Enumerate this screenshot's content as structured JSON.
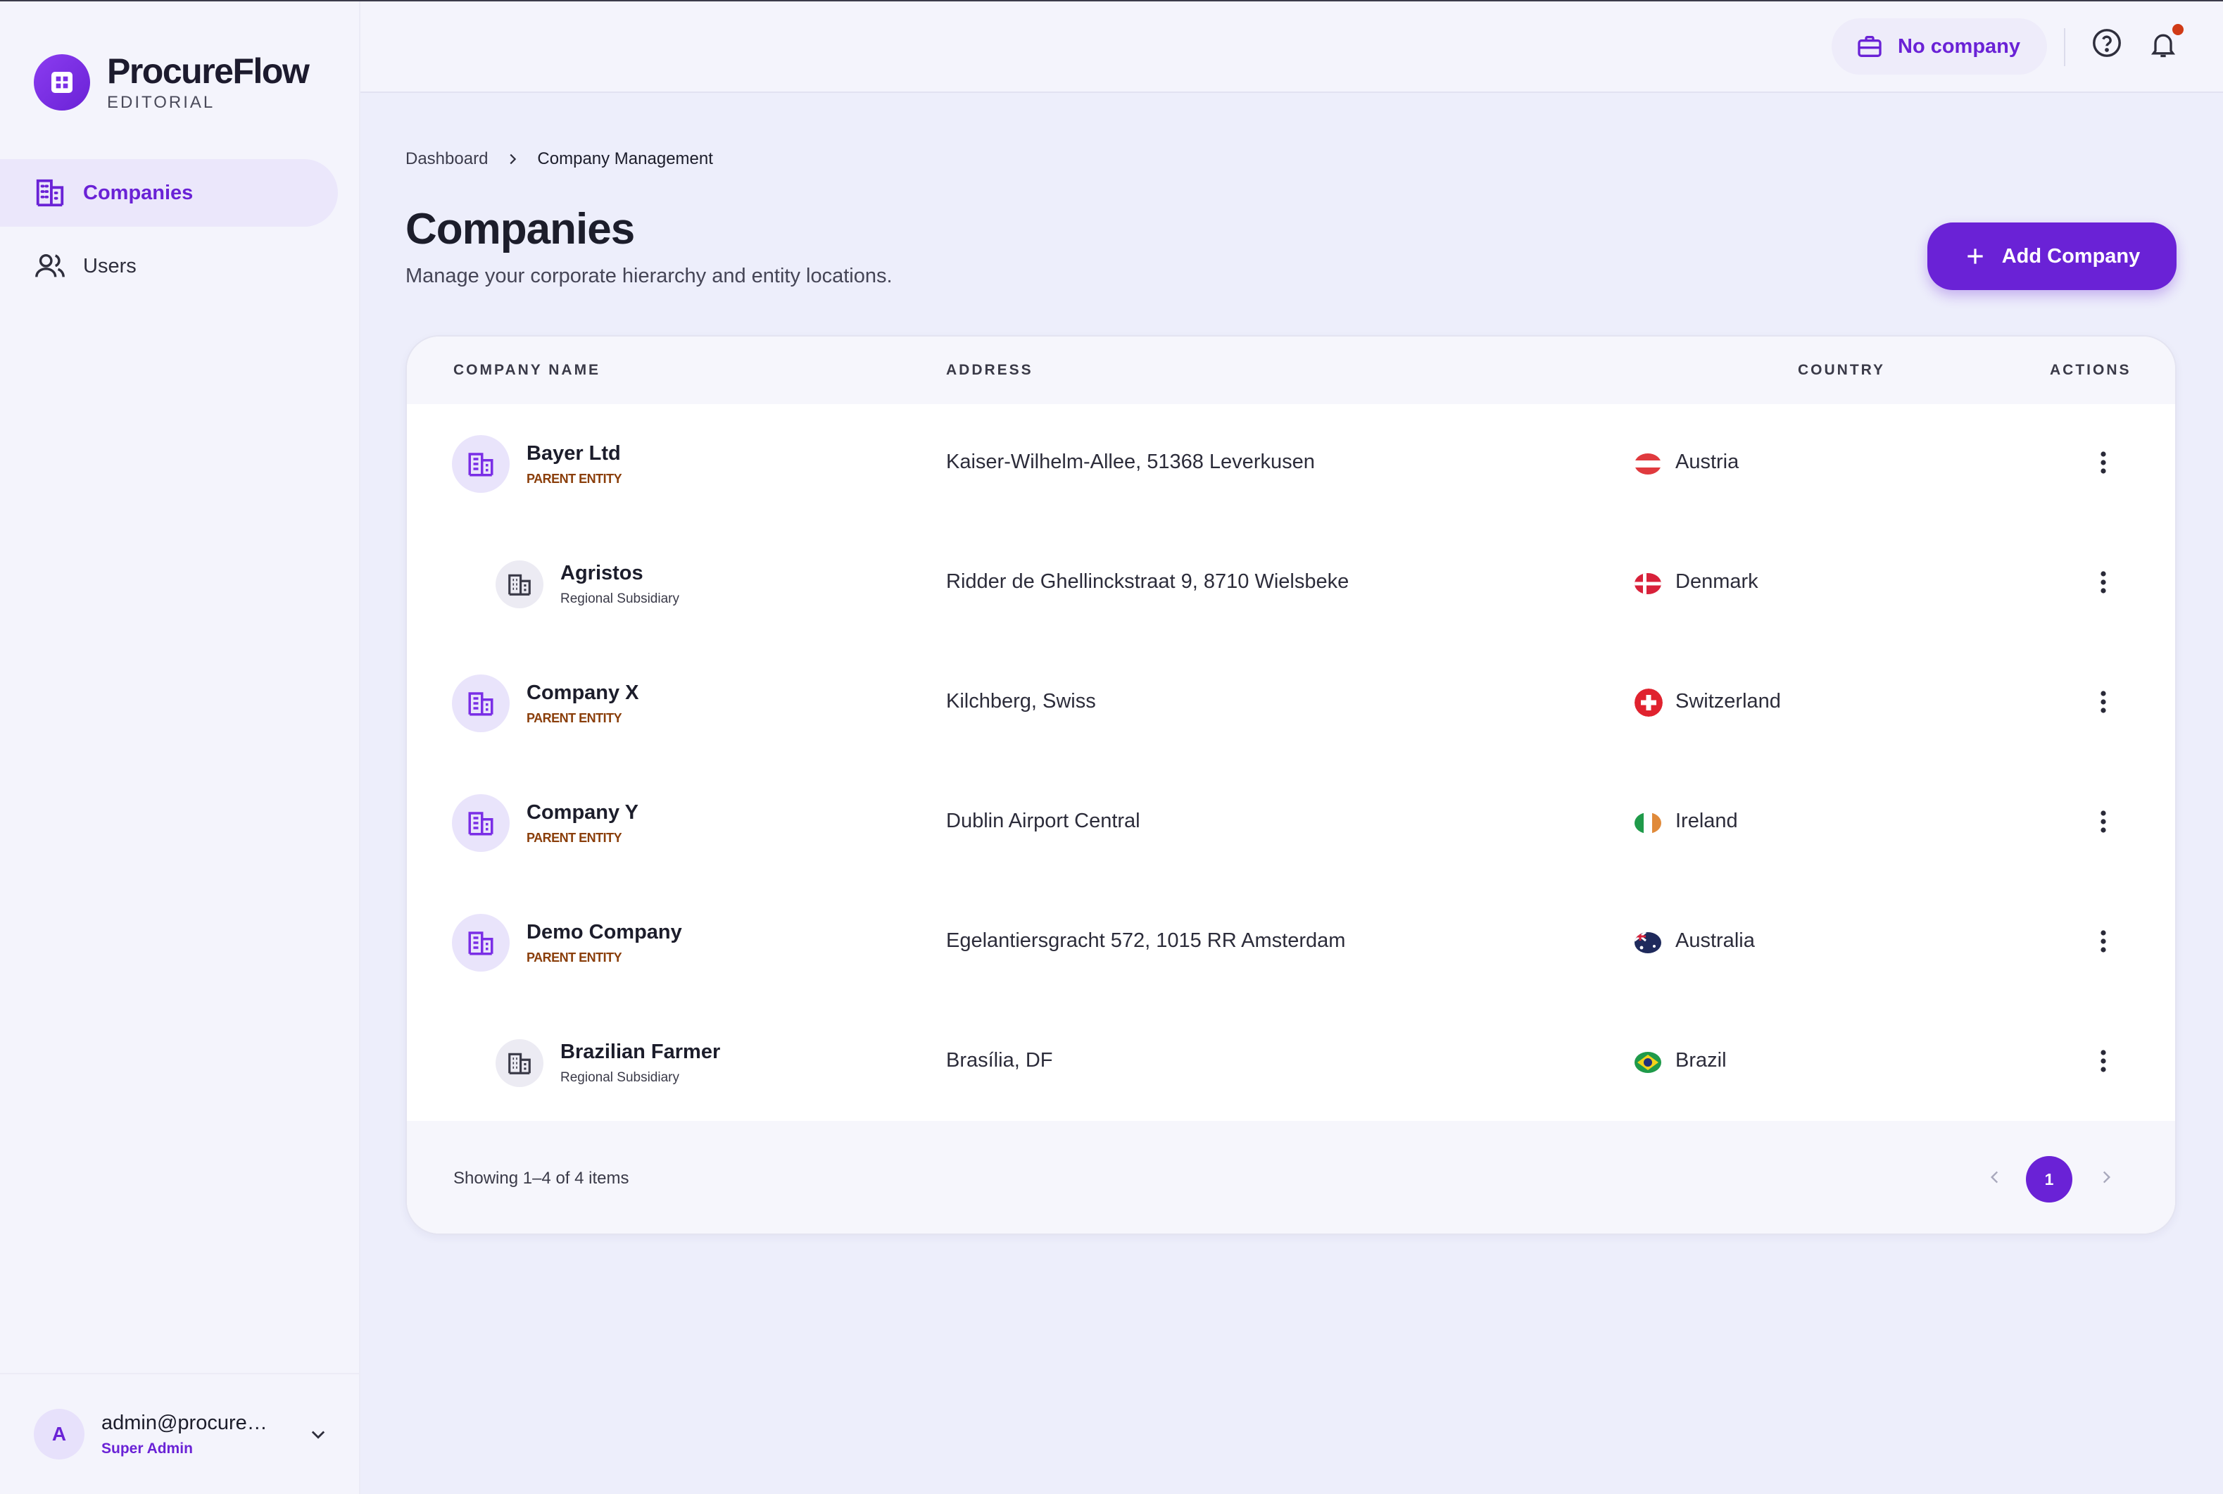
{
  "brand": {
    "name": "ProcureFlow",
    "subtitle": "EDITORIAL"
  },
  "sidebar": {
    "items": [
      {
        "label": "Companies",
        "icon": "building-icon",
        "active": true
      },
      {
        "label": "Users",
        "icon": "users-icon",
        "active": false
      }
    ]
  },
  "user": {
    "avatar_initial": "A",
    "email": "admin@procure…",
    "role": "Super Admin"
  },
  "topbar": {
    "company_selector": "No company"
  },
  "breadcrumb": {
    "home": "Dashboard",
    "current": "Company Management"
  },
  "page": {
    "title": "Companies",
    "subtitle": "Manage your corporate hierarchy and entity locations.",
    "add_button": "Add Company"
  },
  "table": {
    "columns": {
      "name": "COMPANY NAME",
      "address": "ADDRESS",
      "country": "COUNTRY",
      "actions": "ACTIONS"
    },
    "rows": [
      {
        "name": "Bayer Ltd",
        "tag": "PARENT ENTITY",
        "level": "parent",
        "address": "Kaiser-Wilhelm-Allee, 51368 Leverkusen",
        "country": "Austria"
      },
      {
        "name": "Agristos",
        "tag": "Regional Subsidiary",
        "level": "child",
        "address": "Ridder de Ghellinckstraat 9, 8710 Wielsbeke",
        "country": "Denmark"
      },
      {
        "name": "Company X",
        "tag": "PARENT ENTITY",
        "level": "parent",
        "address": "Kilchberg, Swiss",
        "country": "Switzerland"
      },
      {
        "name": "Company Y",
        "tag": "PARENT ENTITY",
        "level": "parent",
        "address": "Dublin Airport Central",
        "country": "Ireland"
      },
      {
        "name": "Demo Company",
        "tag": "PARENT ENTITY",
        "level": "parent",
        "address": "Egelantiersgracht 572, 1015 RR Amsterdam",
        "country": "Australia"
      },
      {
        "name": "Brazilian Farmer",
        "tag": "Regional Subsidiary",
        "level": "child",
        "address": "Brasília, DF",
        "country": "Brazil"
      }
    ],
    "footer": {
      "showing": "Showing 1–4 of 4 items",
      "current_page": "1"
    }
  },
  "colors": {
    "accent": "#6a22d6",
    "parent_tag": "#8a3e0a",
    "notification_dot": "#d03a16"
  }
}
